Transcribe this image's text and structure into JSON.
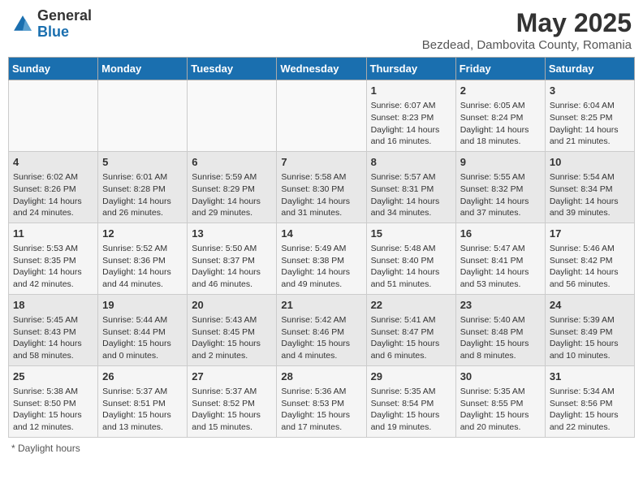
{
  "logo": {
    "general": "General",
    "blue": "Blue"
  },
  "title": "May 2025",
  "subtitle": "Bezdead, Dambovita County, Romania",
  "days_of_week": [
    "Sunday",
    "Monday",
    "Tuesday",
    "Wednesday",
    "Thursday",
    "Friday",
    "Saturday"
  ],
  "weeks": [
    [
      {
        "day": "",
        "detail": ""
      },
      {
        "day": "",
        "detail": ""
      },
      {
        "day": "",
        "detail": ""
      },
      {
        "day": "",
        "detail": ""
      },
      {
        "day": "1",
        "detail": "Sunrise: 6:07 AM\nSunset: 8:23 PM\nDaylight: 14 hours and 16 minutes."
      },
      {
        "day": "2",
        "detail": "Sunrise: 6:05 AM\nSunset: 8:24 PM\nDaylight: 14 hours and 18 minutes."
      },
      {
        "day": "3",
        "detail": "Sunrise: 6:04 AM\nSunset: 8:25 PM\nDaylight: 14 hours and 21 minutes."
      }
    ],
    [
      {
        "day": "4",
        "detail": "Sunrise: 6:02 AM\nSunset: 8:26 PM\nDaylight: 14 hours and 24 minutes."
      },
      {
        "day": "5",
        "detail": "Sunrise: 6:01 AM\nSunset: 8:28 PM\nDaylight: 14 hours and 26 minutes."
      },
      {
        "day": "6",
        "detail": "Sunrise: 5:59 AM\nSunset: 8:29 PM\nDaylight: 14 hours and 29 minutes."
      },
      {
        "day": "7",
        "detail": "Sunrise: 5:58 AM\nSunset: 8:30 PM\nDaylight: 14 hours and 31 minutes."
      },
      {
        "day": "8",
        "detail": "Sunrise: 5:57 AM\nSunset: 8:31 PM\nDaylight: 14 hours and 34 minutes."
      },
      {
        "day": "9",
        "detail": "Sunrise: 5:55 AM\nSunset: 8:32 PM\nDaylight: 14 hours and 37 minutes."
      },
      {
        "day": "10",
        "detail": "Sunrise: 5:54 AM\nSunset: 8:34 PM\nDaylight: 14 hours and 39 minutes."
      }
    ],
    [
      {
        "day": "11",
        "detail": "Sunrise: 5:53 AM\nSunset: 8:35 PM\nDaylight: 14 hours and 42 minutes."
      },
      {
        "day": "12",
        "detail": "Sunrise: 5:52 AM\nSunset: 8:36 PM\nDaylight: 14 hours and 44 minutes."
      },
      {
        "day": "13",
        "detail": "Sunrise: 5:50 AM\nSunset: 8:37 PM\nDaylight: 14 hours and 46 minutes."
      },
      {
        "day": "14",
        "detail": "Sunrise: 5:49 AM\nSunset: 8:38 PM\nDaylight: 14 hours and 49 minutes."
      },
      {
        "day": "15",
        "detail": "Sunrise: 5:48 AM\nSunset: 8:40 PM\nDaylight: 14 hours and 51 minutes."
      },
      {
        "day": "16",
        "detail": "Sunrise: 5:47 AM\nSunset: 8:41 PM\nDaylight: 14 hours and 53 minutes."
      },
      {
        "day": "17",
        "detail": "Sunrise: 5:46 AM\nSunset: 8:42 PM\nDaylight: 14 hours and 56 minutes."
      }
    ],
    [
      {
        "day": "18",
        "detail": "Sunrise: 5:45 AM\nSunset: 8:43 PM\nDaylight: 14 hours and 58 minutes."
      },
      {
        "day": "19",
        "detail": "Sunrise: 5:44 AM\nSunset: 8:44 PM\nDaylight: 15 hours and 0 minutes."
      },
      {
        "day": "20",
        "detail": "Sunrise: 5:43 AM\nSunset: 8:45 PM\nDaylight: 15 hours and 2 minutes."
      },
      {
        "day": "21",
        "detail": "Sunrise: 5:42 AM\nSunset: 8:46 PM\nDaylight: 15 hours and 4 minutes."
      },
      {
        "day": "22",
        "detail": "Sunrise: 5:41 AM\nSunset: 8:47 PM\nDaylight: 15 hours and 6 minutes."
      },
      {
        "day": "23",
        "detail": "Sunrise: 5:40 AM\nSunset: 8:48 PM\nDaylight: 15 hours and 8 minutes."
      },
      {
        "day": "24",
        "detail": "Sunrise: 5:39 AM\nSunset: 8:49 PM\nDaylight: 15 hours and 10 minutes."
      }
    ],
    [
      {
        "day": "25",
        "detail": "Sunrise: 5:38 AM\nSunset: 8:50 PM\nDaylight: 15 hours and 12 minutes."
      },
      {
        "day": "26",
        "detail": "Sunrise: 5:37 AM\nSunset: 8:51 PM\nDaylight: 15 hours and 13 minutes."
      },
      {
        "day": "27",
        "detail": "Sunrise: 5:37 AM\nSunset: 8:52 PM\nDaylight: 15 hours and 15 minutes."
      },
      {
        "day": "28",
        "detail": "Sunrise: 5:36 AM\nSunset: 8:53 PM\nDaylight: 15 hours and 17 minutes."
      },
      {
        "day": "29",
        "detail": "Sunrise: 5:35 AM\nSunset: 8:54 PM\nDaylight: 15 hours and 19 minutes."
      },
      {
        "day": "30",
        "detail": "Sunrise: 5:35 AM\nSunset: 8:55 PM\nDaylight: 15 hours and 20 minutes."
      },
      {
        "day": "31",
        "detail": "Sunrise: 5:34 AM\nSunset: 8:56 PM\nDaylight: 15 hours and 22 minutes."
      }
    ]
  ],
  "footer": "Daylight hours"
}
